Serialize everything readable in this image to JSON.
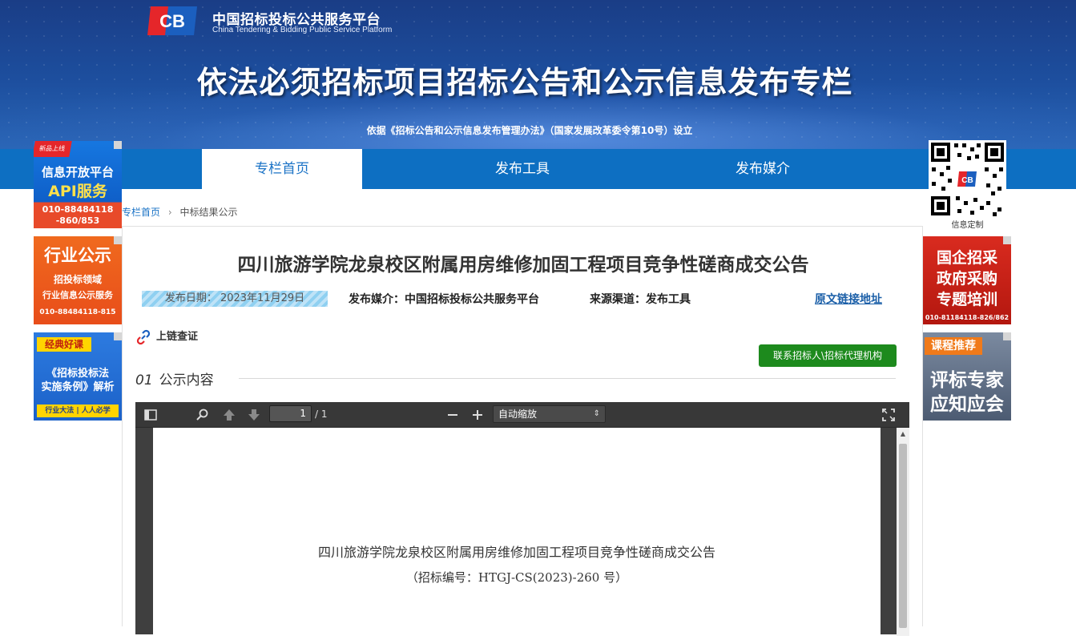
{
  "header": {
    "logo_text": "CB",
    "site_name_cn": "中国招标投标公共服务平台",
    "site_name_en": "China Tendering & Bidding Public Service Platform",
    "banner_title": "依法必须招标项目招标公告和公示信息发布专栏",
    "banner_subtitle": "依据《招标公告和公示信息发布管理办法》（国家发展改革委令第10号）设立"
  },
  "nav": [
    {
      "label": "专栏首页",
      "active": true
    },
    {
      "label": "发布工具",
      "active": false
    },
    {
      "label": "发布媒介",
      "active": false
    }
  ],
  "ads_left": [
    {
      "badge": "新品上线",
      "line1": "信息开放平台",
      "line2": "API服务",
      "phone1": "010-88484118",
      "phone2": "-860/853"
    },
    {
      "line1": "行业公示",
      "line2": "招投标领域",
      "line3": "行业信息公示服务",
      "phone": "010-88484118-815"
    },
    {
      "badge": "经典好课",
      "line1": "《招标投标法",
      "line2": "实施条例》解析",
      "footer": "行业大法 | 人人必学"
    }
  ],
  "ads_right": [
    {
      "line1": "国企招采",
      "line2": "政府采购",
      "line3": "专题培训",
      "phone": "010-81184118-826/862"
    },
    {
      "badge": "课程推荐",
      "line1": "评标专家",
      "line2": "应知应会"
    }
  ],
  "qr": {
    "label": "信息定制",
    "center_text": "CB"
  },
  "breadcrumb": {
    "home": "专栏首页",
    "separator": "›",
    "current": "中标结果公示"
  },
  "article": {
    "title": "四川旅游学院龙泉校区附属用房维修加固工程项目竞争性磋商成交公告",
    "publish_date": "发布日期：  2023年11月29日",
    "media": "发布媒介：中国招标投标公共服务平台",
    "source": "来源渠道：发布工具",
    "original_link": "原文链接地址",
    "chain_label": "上链查证",
    "contact_button": "联系招标人\\招标代理机构",
    "section_num": "01",
    "section_title": "公示内容"
  },
  "viewer": {
    "page_current": "1",
    "page_total": "/ 1",
    "zoom": "自动缩放",
    "doc_title": "四川旅游学院龙泉校区附属用房维修加固工程项目竞争性磋商成交公告",
    "doc_number": "（招标编号：HTGJ-CS(2023)-260 号）"
  },
  "colors": {
    "nav": "#0d6fc2",
    "accent": "#1b73c6",
    "button": "#1d8a1d"
  }
}
